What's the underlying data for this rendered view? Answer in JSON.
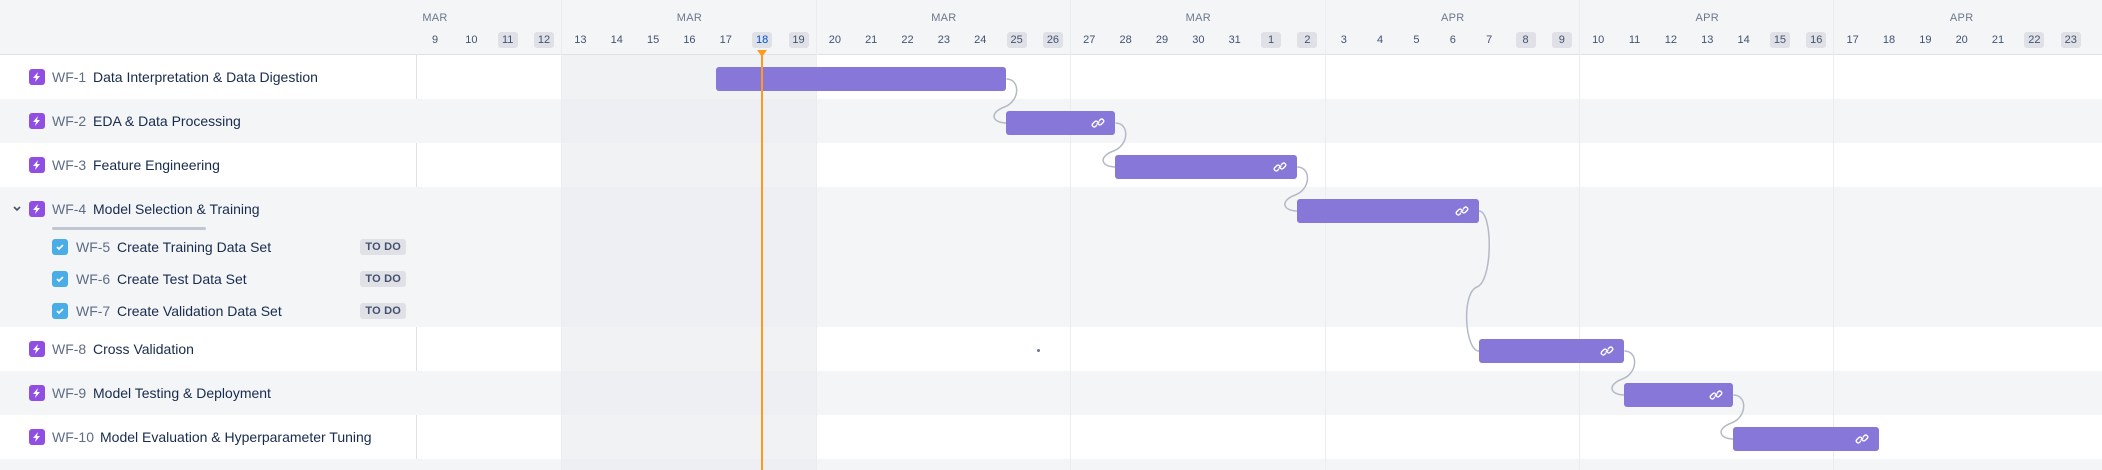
{
  "issues": [
    {
      "key": "WF-1",
      "summary": "Data Interpretation & Data Digestion",
      "type": "epic"
    },
    {
      "key": "WF-2",
      "summary": "EDA & Data Processing",
      "type": "epic"
    },
    {
      "key": "WF-3",
      "summary": "Feature Engineering",
      "type": "epic"
    },
    {
      "key": "WF-4",
      "summary": "Model Selection & Training",
      "type": "epic",
      "expanded": true,
      "children": [
        {
          "key": "WF-5",
          "summary": "Create Training Data Set",
          "status": "TO DO"
        },
        {
          "key": "WF-6",
          "summary": "Create Test Data Set",
          "status": "TO DO"
        },
        {
          "key": "WF-7",
          "summary": "Create Validation Data Set",
          "status": "TO DO"
        }
      ]
    },
    {
      "key": "WF-8",
      "summary": "Cross Validation",
      "type": "epic"
    },
    {
      "key": "WF-9",
      "summary": "Model Testing & Deployment",
      "type": "epic"
    },
    {
      "key": "WF-10",
      "summary": "Model Evaluation & Hyperparameter Tuning",
      "type": "epic"
    }
  ],
  "timeline": {
    "months": [
      "MAR",
      "MAR",
      "MAR",
      "MAR",
      "APR",
      "APR",
      "APR"
    ],
    "days": [
      "9",
      "10",
      "11",
      "12",
      "13",
      "14",
      "15",
      "16",
      "17",
      "18",
      "19",
      "20",
      "21",
      "22",
      "23",
      "24",
      "25",
      "26",
      "27",
      "28",
      "29",
      "30",
      "31",
      "1",
      "2",
      "3",
      "4",
      "5",
      "6",
      "7",
      "8",
      "9",
      "10",
      "11",
      "12",
      "13",
      "14",
      "15",
      "16",
      "17",
      "18",
      "19",
      "20",
      "21",
      "22",
      "23"
    ],
    "weekend_days": [
      "11",
      "12",
      "18",
      "19",
      "25",
      "26",
      "1",
      "2",
      "8",
      "9",
      "15",
      "16",
      "22",
      "23"
    ],
    "today": "18",
    "today_date": "MAR 18",
    "bars": [
      {
        "key": "WF-1",
        "start": "Mar 17",
        "end": "Mar 24",
        "link": false
      },
      {
        "key": "WF-2",
        "start": "Mar 25",
        "end": "Mar 27",
        "link": true
      },
      {
        "key": "WF-3",
        "start": "Mar 28",
        "end": "Apr 1",
        "link": true
      },
      {
        "key": "WF-4",
        "start": "Apr 2",
        "end": "Apr 6",
        "link": true
      },
      {
        "key": "WF-8",
        "start": "Apr 7",
        "end": "Apr 10",
        "link": true
      },
      {
        "key": "WF-9",
        "start": "Apr 11",
        "end": "Apr 13",
        "link": true
      },
      {
        "key": "WF-10",
        "start": "Apr 14",
        "end": "Apr 17",
        "link": true
      }
    ]
  },
  "colors": {
    "bar": "#8777d9",
    "epic_icon": "#904ee2",
    "task_icon": "#4bade8",
    "today_line": "#ff991f",
    "dependency_line": "#b3bac5"
  },
  "icons": {
    "epic": "lightning-icon",
    "task": "checkbox-icon",
    "expand": "chevron-down-icon",
    "link": "link-icon"
  }
}
